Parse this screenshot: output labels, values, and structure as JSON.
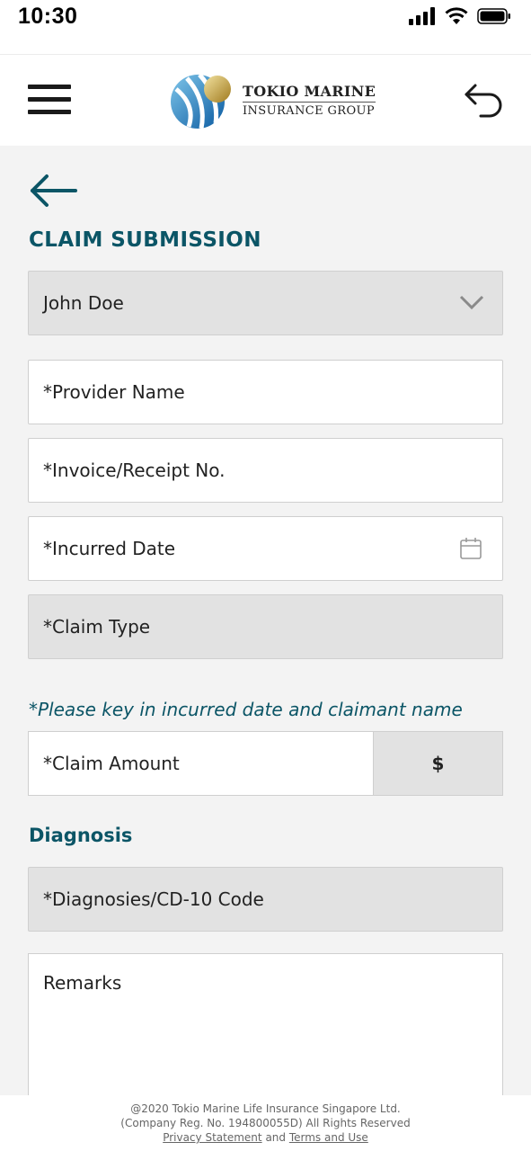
{
  "status_bar": {
    "time": "10:30"
  },
  "header": {
    "logo_line1": "TOKIO MARINE",
    "logo_line2": "INSURANCE GROUP"
  },
  "page": {
    "title": "CLAIM SUBMISSION"
  },
  "form": {
    "claimant": {
      "value": "John Doe"
    },
    "provider_name": {
      "placeholder": "*Provider Name"
    },
    "invoice_no": {
      "placeholder": "*Invoice/Receipt No."
    },
    "incurred_date": {
      "placeholder": "*Incurred Date"
    },
    "claim_type": {
      "placeholder": "*Claim Type"
    },
    "hint": "*Please key in incurred date and claimant name",
    "claim_amount": {
      "placeholder": "*Claim Amount",
      "currency": "$"
    },
    "diagnosis_label": "Diagnosis",
    "diagnosis_code": {
      "placeholder": "*Diagnosies/CD-10 Code"
    },
    "remarks": {
      "placeholder": "Remarks"
    }
  },
  "footer": {
    "copyright": "@2020 Tokio Marine Life Insurance Singapore Ltd.",
    "reg": "(Company Reg. No. 194800055D) All Rights Reserved",
    "privacy": "Privacy Statement",
    "and": "and",
    "terms": "Terms and Use"
  },
  "colors": {
    "accent": "#0b5566",
    "field_disabled": "#e2e2e2",
    "background": "#f3f3f3"
  },
  "icons": [
    "signal-icon",
    "wifi-icon",
    "battery-icon",
    "menu-icon",
    "undo-icon",
    "back-arrow-icon",
    "chevron-down-icon",
    "calendar-icon"
  ]
}
